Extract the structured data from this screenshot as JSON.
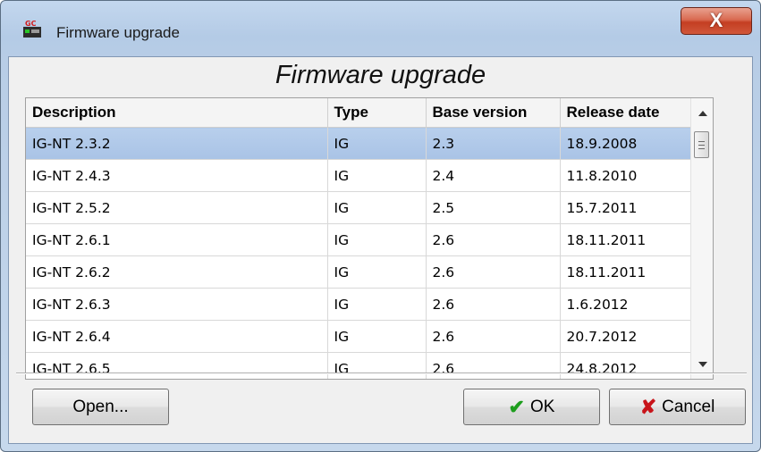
{
  "window": {
    "title": "Firmware upgrade",
    "close_glyph": "X",
    "app_icon_text": "GC"
  },
  "heading": "Firmware upgrade",
  "table": {
    "columns": [
      "Description",
      "Type",
      "Base version",
      "Release date"
    ],
    "rows": [
      [
        "IG-NT 2.3.2",
        "IG",
        "2.3",
        "18.9.2008"
      ],
      [
        "IG-NT 2.4.3",
        "IG",
        "2.4",
        "11.8.2010"
      ],
      [
        "IG-NT 2.5.2",
        "IG",
        "2.5",
        "15.7.2011"
      ],
      [
        "IG-NT 2.6.1",
        "IG",
        "2.6",
        "18.11.2011"
      ],
      [
        "IG-NT 2.6.2",
        "IG",
        "2.6",
        "18.11.2011"
      ],
      [
        "IG-NT 2.6.3",
        "IG",
        "2.6",
        "1.6.2012"
      ],
      [
        "IG-NT 2.6.4",
        "IG",
        "2.6",
        "20.7.2012"
      ],
      [
        "IG-NT 2.6.5",
        "IG",
        "2.6",
        "24.8.2012"
      ],
      [
        "",
        "",
        "",
        ""
      ]
    ],
    "selected_row": 0
  },
  "buttons": {
    "open": "Open...",
    "ok": "OK",
    "cancel": "Cancel",
    "ok_icon": "checkmark-icon",
    "cancel_icon": "cross-icon"
  },
  "colors": {
    "selection": "#aec6e8",
    "close": "#c94a30",
    "ok_check": "#1e9e1e",
    "cancel_cross": "#c8141a"
  }
}
